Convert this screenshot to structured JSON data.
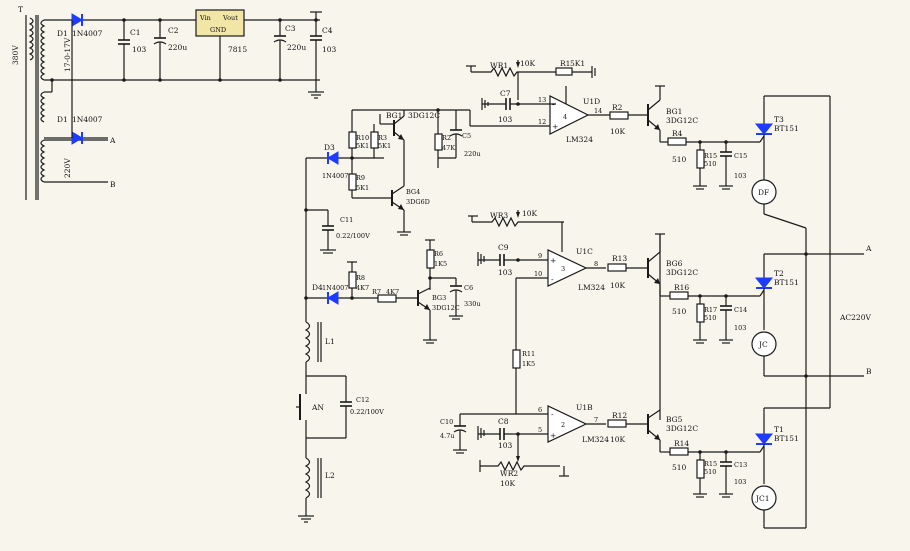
{
  "labels": {
    "T": "T",
    "v380": "380V",
    "v17": "17-0-17V",
    "v220": "220V",
    "D1": "D1",
    "D1a": "1N4007",
    "D2": "D1",
    "D2a": "1N4007",
    "A_in": "A",
    "B_in": "B",
    "C1": "C1",
    "C1v": "103",
    "C2": "C2",
    "C2v": "220u",
    "reg_vin": "Vin",
    "reg_vout": "Vout",
    "reg_gnd": "GND",
    "reg_name": "7815",
    "C3": "C3",
    "C3v": "220u",
    "C4": "C4",
    "C4v": "103",
    "WR1": "WR1",
    "WR1v": "10K",
    "R1": "R1",
    "R1v": "5K1",
    "C7": "C7",
    "C7v": "103",
    "U1D": "U1D",
    "U1D_p13": "13",
    "U1D_p12": "12",
    "U1D_p14": "14",
    "U1D_n": "4",
    "U1D_chip": "LM324",
    "R2": "R2",
    "R2v": "10K",
    "BG1b": "BG1",
    "BG1bv": "3DG12C",
    "R4": "R4",
    "R4v": "510",
    "R15": "R15",
    "R15v": "510",
    "C15": "C15",
    "C15v": "103",
    "T3": "T3",
    "T3v": "BT151",
    "DF": "DF",
    "BG1a": "BG1",
    "BG1av": "3DG12C",
    "R10": "R10",
    "R10v": "5K1",
    "R3": "R3",
    "R3v": "5K1",
    "R2b": "R2",
    "R2bv": "47K",
    "C5": "C5",
    "C5v": "220u",
    "R9": "R9",
    "R9v": "5K1",
    "BG4": "BG4",
    "BG4v": "3DG6D",
    "D3": "D3",
    "D3v": "1N4007",
    "C11": "C11",
    "C11v": "0.22/100V",
    "WR3": "WR3",
    "WR3v": "10K",
    "C9": "C9",
    "C9v": "103",
    "U1C": "U1C",
    "U1C_p9": "9",
    "U1C_p10": "10",
    "U1C_p8": "8",
    "U1C_n": "3",
    "U1C_chip": "LM324",
    "R13": "R13",
    "R13v": "10K",
    "BG6": "BG6",
    "BG6v": "3DG12C",
    "R16": "R16",
    "R16v": "510",
    "R17": "R17",
    "R17v": "510",
    "C14": "C14",
    "C14v": "103",
    "T2": "T2",
    "T2v": "BT151",
    "JC": "JC",
    "R6": "R6",
    "R6v": "1K5",
    "R8": "R8",
    "R8v": "4K7",
    "R7": "R7",
    "R7v": "4K7",
    "BG3": "BG3",
    "BG3v": "3DG12C",
    "C6": "C6",
    "C6v": "330u",
    "D4": "D4",
    "D4v": "1N4007",
    "L1": "L1",
    "AN": "AN",
    "C12": "C12",
    "C12v": "0.22/100V",
    "L2": "L2",
    "R11": "R11",
    "R11v": "1K5",
    "C10": "C10",
    "C10v": "4.7u",
    "C8": "C8",
    "C8v": "103",
    "U1B": "U1B",
    "U1B_p6": "6",
    "U1B_p5": "5",
    "U1B_p7": "7",
    "U1B_n": "2",
    "U1B_chip": "LM324",
    "WR2": "WR2",
    "WR2v": "10K",
    "R12": "R12",
    "R12v": "10K",
    "BG5": "BG5",
    "BG5v": "3DG12C",
    "R14": "R14",
    "R14v": "510",
    "R15b": "R15",
    "R15bv": "510",
    "C13": "C13",
    "C13v": "103",
    "T1": "T1",
    "T1v": "BT151",
    "JC1": "JC1",
    "A_out": "A",
    "B_out": "B",
    "AC220": "AC220V"
  }
}
